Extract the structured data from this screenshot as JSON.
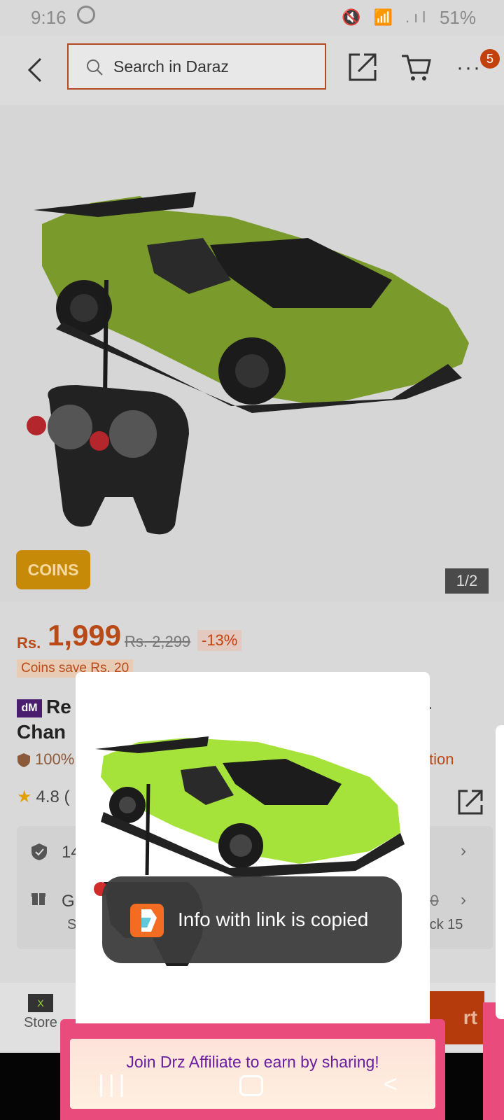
{
  "status_bar": {
    "time": "9:16",
    "icons": "🔇 📶 .ıl",
    "battery": "51%"
  },
  "header": {
    "search_placeholder": "Search in Daraz",
    "cart_badge": "5"
  },
  "gallery": {
    "indicator": "1/2",
    "coins_tag": "COINS"
  },
  "price": {
    "currency": "Rs.",
    "value": "1,999",
    "old_price": "Rs. 2,299",
    "discount": "-13%",
    "coins_save": "Coins save Rs. 20"
  },
  "product": {
    "store_badge": "dM",
    "title_start": "Re",
    "title_line2": "Chan",
    "title_tail": "4",
    "positive_rating": "100%",
    "protection": "ction",
    "rating": "4.8 (",
    "rating_tail": ")"
  },
  "info": {
    "line1": "14",
    "line2": "G",
    "line3": "S",
    "right1": "140",
    "right2": "lock 15"
  },
  "bottom_bar": {
    "store_label": "Store",
    "store_logo": "PLANET X",
    "add_cart_tail": "rt"
  },
  "share_modal": {
    "toast": "Info with link is copied",
    "affiliate_banner": "Join Drz Affiliate to earn by sharing!"
  },
  "colors": {
    "brand": "#f36c21",
    "price": "#b84a18",
    "affiliate": "#e84b7c"
  }
}
